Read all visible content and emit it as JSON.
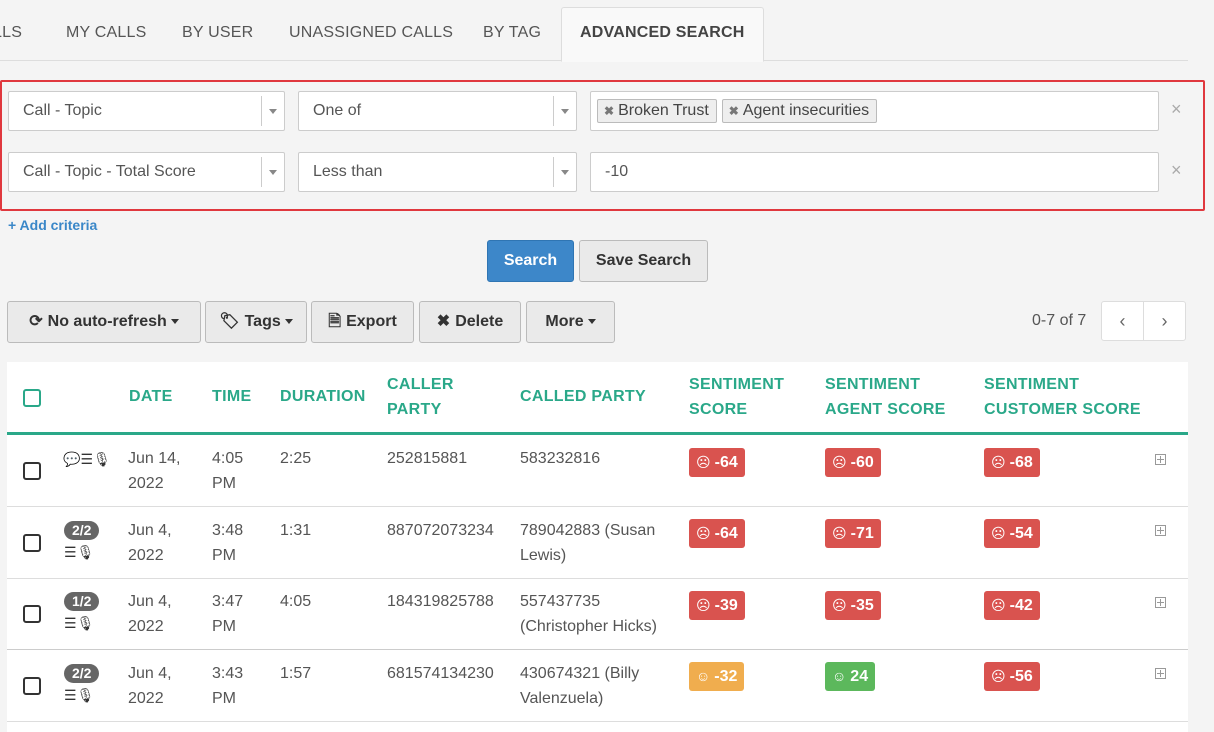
{
  "tabs": [
    "LLS",
    "MY CALLS",
    "BY USER",
    "UNASSIGNED CALLS",
    "BY TAG",
    "ADVANCED SEARCH"
  ],
  "criteria": [
    {
      "field": "Call - Topic",
      "operator": "One of",
      "tags": [
        "Broken Trust",
        "Agent insecurities"
      ],
      "remove": "×"
    },
    {
      "field": "Call - Topic - Total Score",
      "operator": "Less than",
      "value": "-10",
      "remove": "×"
    }
  ],
  "add_criteria": "+ Add criteria",
  "buttons": {
    "search": "Search",
    "save_search": "Save Search"
  },
  "toolbar": {
    "refresh": "No auto-refresh",
    "tags": "Tags",
    "export": "Export",
    "delete": "Delete",
    "more": "More"
  },
  "pagination": {
    "range": "0-7 of 7",
    "prev": "‹",
    "next": "›"
  },
  "table": {
    "headers": {
      "date": "DATE",
      "time": "TIME",
      "duration": "DURATION",
      "caller": [
        "CALLER",
        "PARTY"
      ],
      "called": "CALLED PARTY",
      "sentiment": [
        "SENTIMENT",
        "SCORE"
      ],
      "agent": [
        "SENTIMENT",
        "AGENT SCORE"
      ],
      "customer": [
        "SENTIMENT",
        "CUSTOMER SCORE"
      ]
    },
    "rows": [
      {
        "badge": "",
        "date": [
          "Jun 14,",
          "2022"
        ],
        "time": [
          "4:05",
          "PM"
        ],
        "duration": "2:25",
        "caller": "252815881",
        "called": [
          "583232816",
          ""
        ],
        "score": "-64",
        "agent": "-60",
        "customer": "-68"
      },
      {
        "badge": "2/2",
        "date": [
          "Jun 4,",
          "2022"
        ],
        "time": [
          "3:48",
          "PM"
        ],
        "duration": "1:31",
        "caller": "887072073234",
        "called": [
          "789042883 (Susan",
          "Lewis)"
        ],
        "score": "-64",
        "agent": "-71",
        "customer": "-54"
      },
      {
        "badge": "1/2",
        "date": [
          "Jun 4,",
          "2022"
        ],
        "time": [
          "3:47",
          "PM"
        ],
        "duration": "4:05",
        "caller": "184319825788",
        "called": [
          "557437735",
          "(Christopher Hicks)"
        ],
        "score": "-39",
        "agent": "-35",
        "customer": "-42"
      },
      {
        "badge": "2/2",
        "date": [
          "Jun 4,",
          "2022"
        ],
        "time": [
          "3:43",
          "PM"
        ],
        "duration": "1:57",
        "caller": "681574134230",
        "called": [
          "430674321 (Billy",
          "Valenzuela)"
        ],
        "score": "-32",
        "agent": "24",
        "customer": "-56"
      }
    ]
  },
  "colors": {
    "accent": "#2aa889",
    "negative": "#d9534f",
    "warning": "#f0ad4e",
    "positive": "#5cb85c",
    "primary": "#3d87c9",
    "highlight_border": "#e0383e"
  }
}
